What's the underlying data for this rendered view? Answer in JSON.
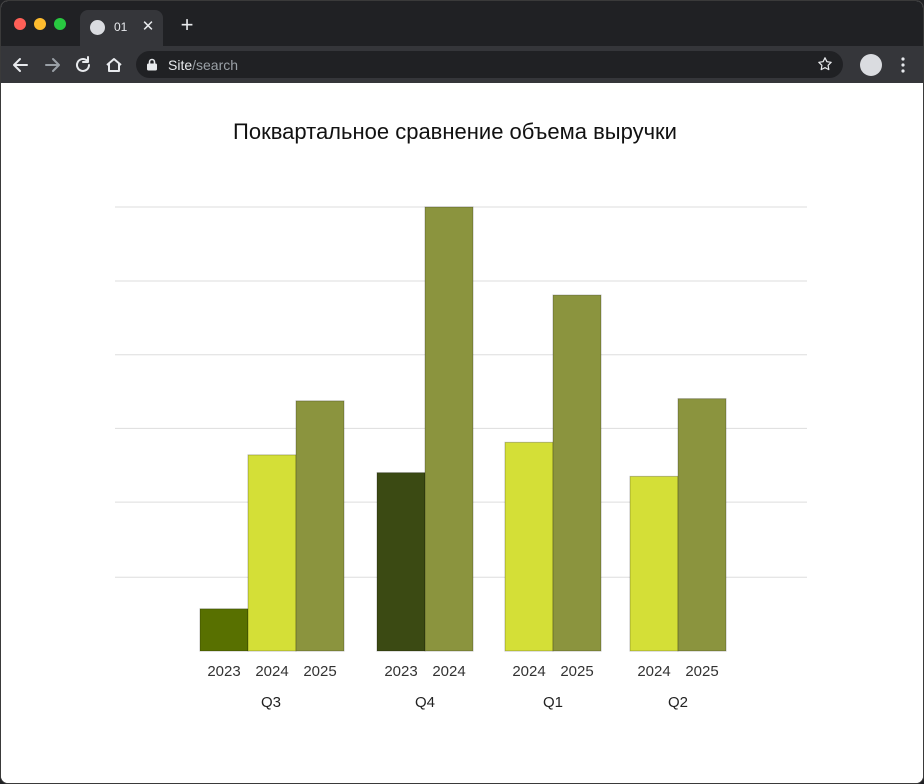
{
  "browser": {
    "tab_title": "01",
    "tab_close_glyph": "✕",
    "new_tab_glyph": "+",
    "url_host": "Site",
    "url_path": "/search",
    "icons": [
      "back-arrow-icon",
      "forward-arrow-icon",
      "reload-icon",
      "home-icon",
      "lock-icon",
      "star-icon",
      "profile-avatar",
      "kebab-menu-icon"
    ]
  },
  "chart_data": {
    "type": "bar",
    "title": "Поквартальное сравнение объема выручки",
    "xlabel": "",
    "ylabel": "",
    "ylim": [
      0,
      6
    ],
    "grid": true,
    "legend": "none",
    "groups": [
      {
        "name": "Q3",
        "bars": [
          {
            "label": "2023",
            "value": 0.57,
            "color": "#587000"
          },
          {
            "label": "2024",
            "value": 2.65,
            "color": "#d4df37"
          },
          {
            "label": "2025",
            "value": 3.38,
            "color": "#8b943e"
          }
        ]
      },
      {
        "name": "Q4",
        "bars": [
          {
            "label": "2023",
            "value": 2.41,
            "color": "#3b4a13"
          },
          {
            "label": "2024",
            "value": 6.0,
            "color": "#8b943e"
          }
        ]
      },
      {
        "name": "Q1",
        "bars": [
          {
            "label": "2024",
            "value": 2.82,
            "color": "#d4df37"
          },
          {
            "label": "2025",
            "value": 4.81,
            "color": "#8b943e"
          }
        ]
      },
      {
        "name": "Q2",
        "bars": [
          {
            "label": "2024",
            "value": 2.36,
            "color": "#d4df37"
          },
          {
            "label": "2025",
            "value": 3.41,
            "color": "#8b943e"
          }
        ]
      }
    ]
  }
}
